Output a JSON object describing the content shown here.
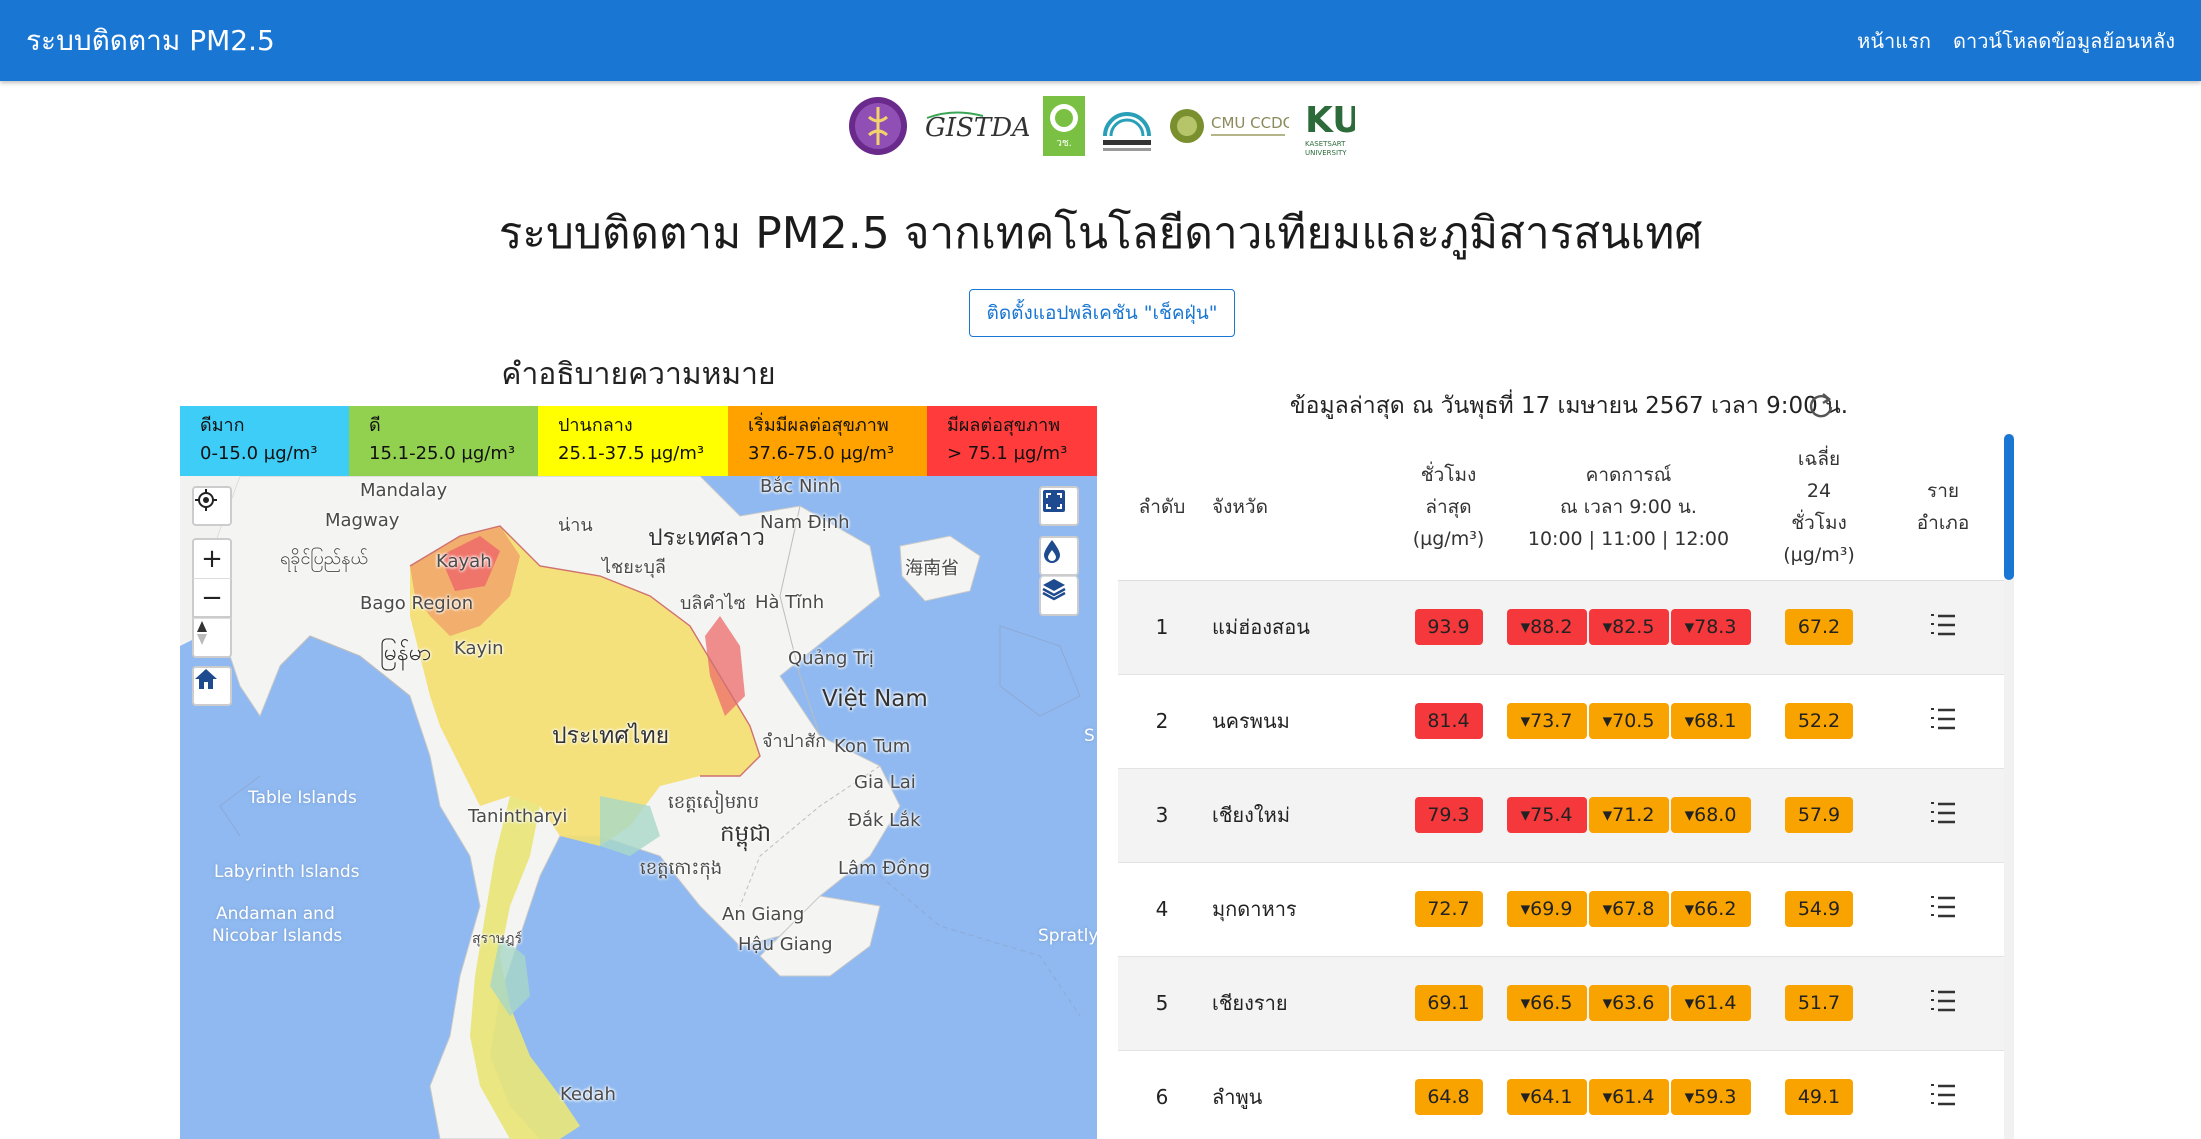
{
  "nav": {
    "brand": "ระบบติดตาม PM2.5",
    "links": [
      "หน้าแรก",
      "ดาวน์โหลดข้อมูลย้อนหลัง"
    ]
  },
  "logos": {
    "gistda": "GISTDA",
    "nrct": "วช. NRCT",
    "cmu": "CMU CCDC",
    "ku": "KU",
    "ku_sub": "KASETSART UNIVERSITY"
  },
  "page_title": "ระบบติดตาม PM2.5 จากเทคโนโลยีดาวเทียมและภูมิสารสนเทศ",
  "install_button": "ติดตั้งแอปพลิเคชัน \"เช็คฝุ่น\"",
  "legend": {
    "title": "คำอธิบายความหมาย",
    "items": [
      {
        "label": "ดีมาก",
        "range": "0-15.0 µg/m³",
        "color": "#3ecdf7"
      },
      {
        "label": "ดี",
        "range": "15.1-25.0 µg/m³",
        "color": "#92d050"
      },
      {
        "label": "ปานกลาง",
        "range": "25.1-37.5 µg/m³",
        "color": "#ffff00"
      },
      {
        "label": "เริ่มมีผลต่อสุขภาพ",
        "range": "37.6-75.0 µg/m³",
        "color": "#ffa200"
      },
      {
        "label": "มีผลต่อสุขภาพ",
        "range": "> 75.1 µg/m³",
        "color": "#ff3b3b"
      }
    ]
  },
  "map": {
    "labels": {
      "mandalay": "Mandalay",
      "magway": "Magway",
      "myanmar_region": "ရခိုင်ပြည်နယ်",
      "kayah": "Kayah",
      "bago": "Bago Region",
      "myanmar": "မြန်မာ",
      "kayin": "Kayin",
      "bac_ninh": "Bắc Ninh",
      "nam_dinh": "Nam Định",
      "laos": "ประเทศลาว",
      "hainan": "海南省",
      "nan": "น่าน",
      "sayabouly": "ไชยะบุลี",
      "bolikhamxay": "บลิคำไซ",
      "ha_tinh": "Hà Tĩnh",
      "quang_tri": "Quảng Trị",
      "vietnam": "Việt Nam",
      "thailand": "ประเทศไทย",
      "champasak": "จำปาสัก",
      "kon_tum": "Kon Tum",
      "gia_lai": "Gia Lai",
      "dak_lak": "Đắk Lắk",
      "cambodia": "កម្ពុជា",
      "cambodia_region": "ខេត្តសៀមរាប",
      "kohkong": "ខេត្តកោះកុង",
      "lam_dong": "Lâm Đồng",
      "tanintharyi": "Tanintharyi",
      "table_islands": "Table Islands",
      "labyrinth": "Labyrinth Islands",
      "andaman": "Andaman and",
      "nicobar": "Nicobar Islands",
      "an_giang": "An Giang",
      "hau_giang": "Hậu Giang",
      "surat": "สุราษฎร์",
      "spratly": "Spratly",
      "kedah": "Kedah",
      "edge_s": "S"
    },
    "controls": {
      "locate": "crosshair-icon",
      "zoom_in": "+",
      "zoom_out": "−",
      "compass": "compass-icon",
      "home": "home-icon",
      "fullscreen": "fullscreen-icon",
      "drop": "drop-icon",
      "layers": "layers-icon"
    }
  },
  "latest_text": "ข้อมูลล่าสุด ณ วันพุธที่ 17 เมษายน 2567 เวลา 9:00 น.",
  "table": {
    "headers": {
      "rank": "ลำดับ",
      "province": "จังหวัด",
      "hour_l1": "ชั่วโมง",
      "hour_l2": "ล่าสุด",
      "hour_l3": "(µg/m³)",
      "fc_l1": "คาดการณ์",
      "fc_l2": "ณ เวลา 9:00 น.",
      "fc_l3": "10:00 | 11:00 | 12:00",
      "avg_l1": "เฉลี่ย",
      "avg_l2": "24",
      "avg_l3": "ชั่วโมง",
      "avg_l4": "(µg/m³)",
      "dist_l1": "ราย",
      "dist_l2": "อำเภอ"
    },
    "rows": [
      {
        "rank": "1",
        "province": "แม่ฮ่องสอน",
        "hour": "93.9",
        "f1": "▾88.2",
        "f2": "▾82.5",
        "f3": "▾78.3",
        "avg": "67.2"
      },
      {
        "rank": "2",
        "province": "นครพนม",
        "hour": "81.4",
        "f1": "▾73.7",
        "f2": "▾70.5",
        "f3": "▾68.1",
        "avg": "52.2"
      },
      {
        "rank": "3",
        "province": "เชียงใหม่",
        "hour": "79.3",
        "f1": "▾75.4",
        "f2": "▾71.2",
        "f3": "▾68.0",
        "avg": "57.9"
      },
      {
        "rank": "4",
        "province": "มุกดาหาร",
        "hour": "72.7",
        "f1": "▾69.9",
        "f2": "▾67.8",
        "f3": "▾66.2",
        "avg": "54.9"
      },
      {
        "rank": "5",
        "province": "เชียงราย",
        "hour": "69.1",
        "f1": "▾66.5",
        "f2": "▾63.6",
        "f3": "▾61.4",
        "avg": "51.7"
      },
      {
        "rank": "6",
        "province": "ลำพูน",
        "hour": "64.8",
        "f1": "▾64.1",
        "f2": "▾61.4",
        "f3": "▾59.3",
        "avg": "49.1"
      }
    ]
  },
  "colors": {
    "navbar": "#1976d2",
    "red": "#f4383c",
    "orange": "#f9a300"
  }
}
